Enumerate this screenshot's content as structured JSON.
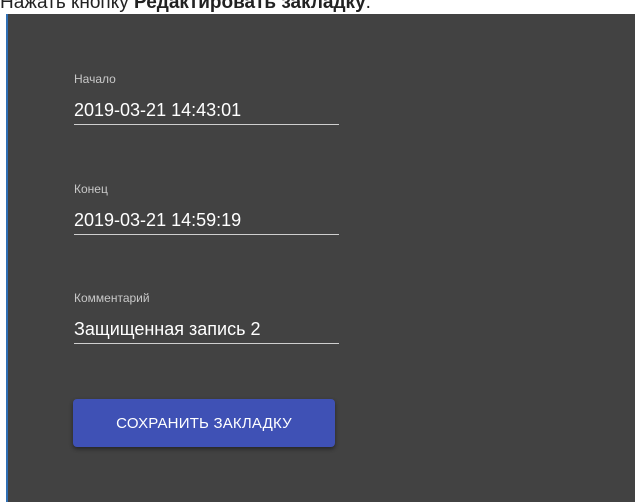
{
  "instruction": {
    "prefix": "Нажать кнопку ",
    "bold": "Редактировать закладку",
    "suffix": "."
  },
  "form": {
    "start": {
      "label": "Начало",
      "value": "2019-03-21 14:43:01"
    },
    "end": {
      "label": "Конец",
      "value": "2019-03-21 14:59:19"
    },
    "comment": {
      "label": "Комментарий",
      "value": "Защищенная запись 2"
    }
  },
  "save_button": {
    "label": "СОХРАНИТЬ ЗАКЛАДКУ"
  },
  "colors": {
    "panel_background": "#424242",
    "button_accent": "#3f51b5",
    "panel_edge": "#2f6fb4"
  }
}
